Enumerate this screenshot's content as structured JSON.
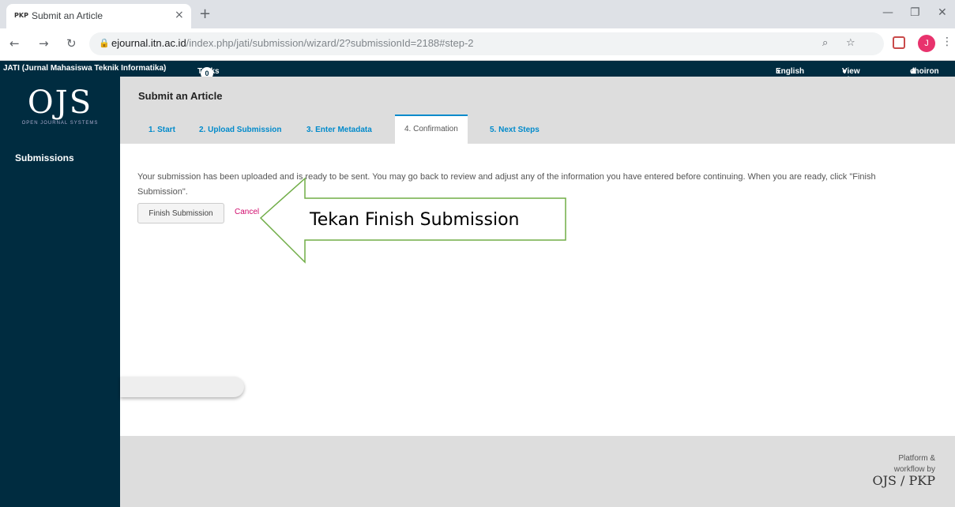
{
  "browser": {
    "tab_favicon": "PKP",
    "tab_title": "Submit an Article",
    "tab_close": "×",
    "new_tab": "+",
    "url_host": "ejournal.itn.ac.id",
    "url_path": "/index.php/jati/submission/wizard/2?submissionId=2188#step-2",
    "avatar_letter": "J"
  },
  "ojs_header": {
    "journal_name": "JATI (Jurnal Mahasiswa Teknik Informatika)",
    "tasks_label": "Tasks",
    "tasks_count": "0",
    "language": "English",
    "view_site": "View Site",
    "user": "choiron"
  },
  "sidebar": {
    "logo_text": "OJS",
    "logo_sub": "OPEN JOURNAL SYSTEMS",
    "section": "Submissions"
  },
  "page": {
    "title": "Submit an Article",
    "steps": [
      "1. Start",
      "2. Upload Submission",
      "3. Enter Metadata",
      "4. Confirmation",
      "5. Next Steps"
    ],
    "active_step": 3,
    "message": "Your submission has been uploaded and is ready to be sent. You may go back to review and adjust any of the information you have entered before continuing. When you are ready, click \"Finish Submission\".",
    "finish_button": "Finish Submission",
    "cancel_link": "Cancel"
  },
  "footer": {
    "credit_line1": "Platform &",
    "credit_line2": "workflow by",
    "credit_logo": "OJS / PKP"
  },
  "annotation": {
    "callout_text": "Tekan Finish Submission",
    "arrow_color": "#70ad47"
  }
}
